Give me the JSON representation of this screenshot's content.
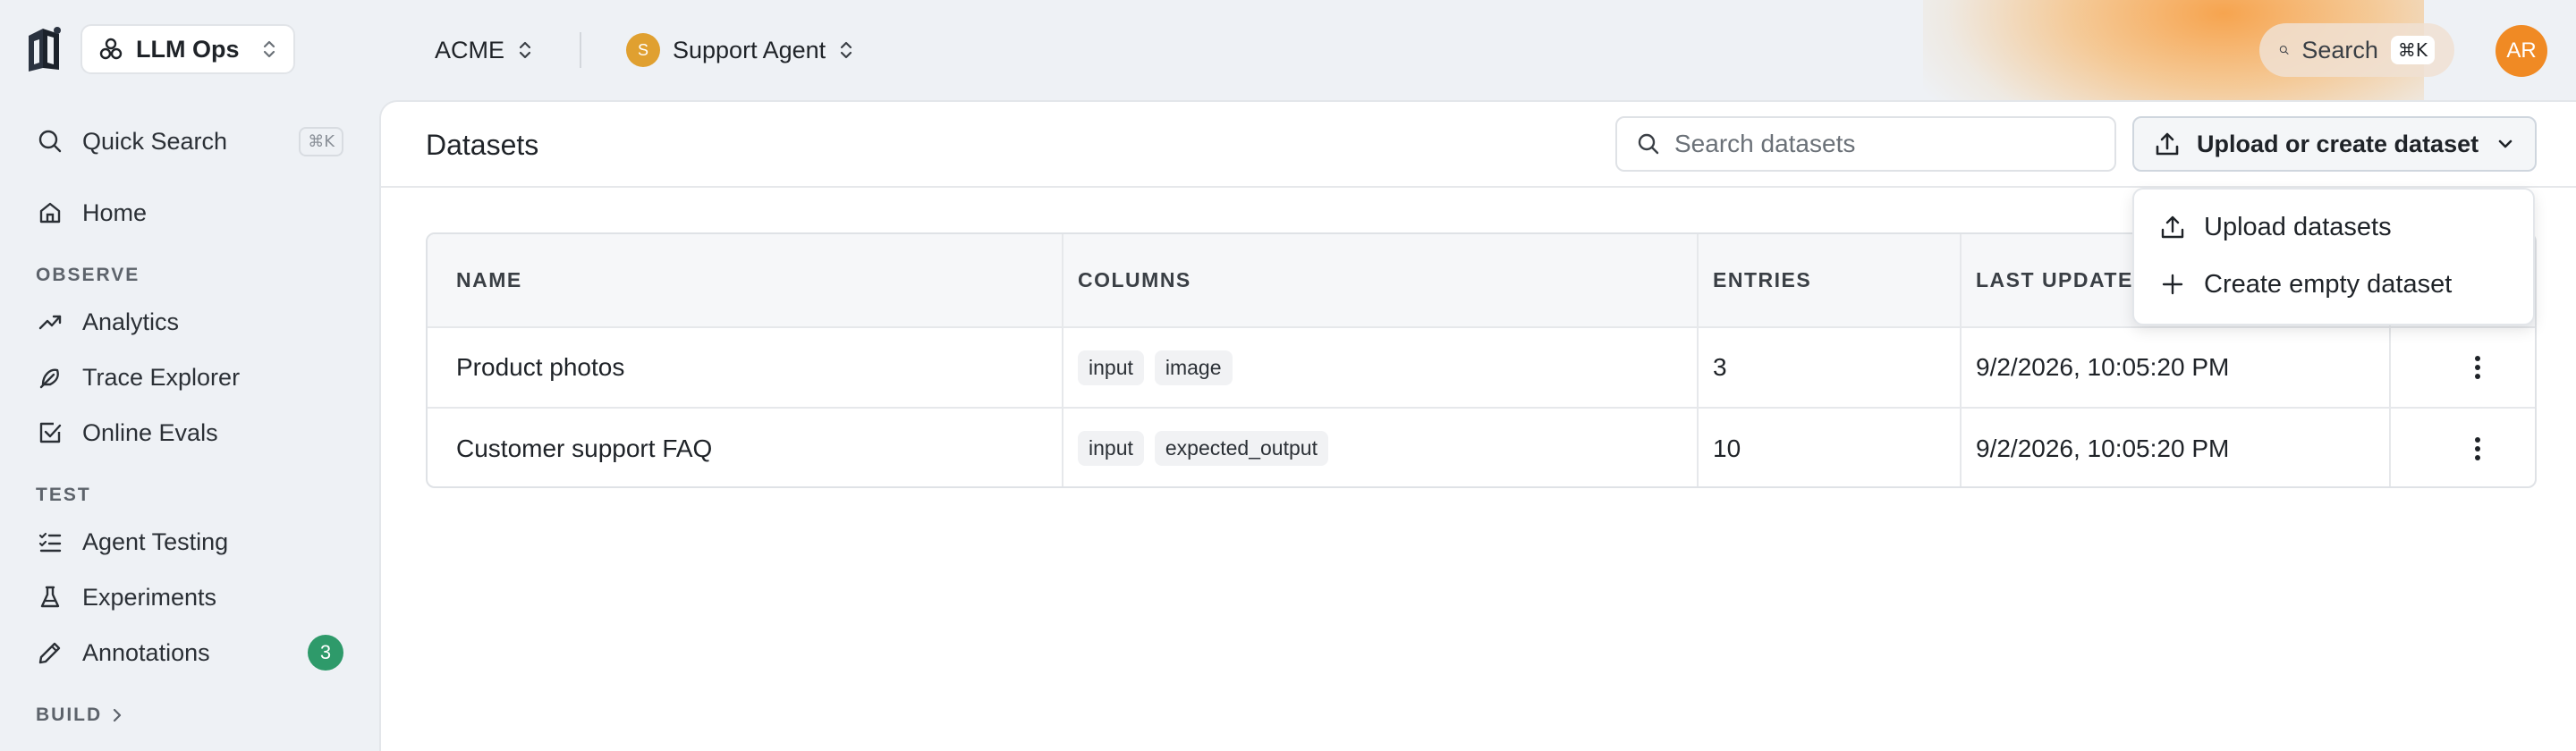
{
  "topbar": {
    "project": "LLM Ops",
    "org": "ACME",
    "agent": {
      "avatar_letter": "S",
      "name": "Support Agent"
    },
    "search": {
      "label": "Search",
      "shortcut": "⌘K"
    },
    "user_initials": "AR"
  },
  "sidebar": {
    "quick_search": {
      "label": "Quick Search",
      "shortcut": "⌘K"
    },
    "home": "Home",
    "sections": {
      "observe": "OBSERVE",
      "test": "TEST",
      "build": "BUILD"
    },
    "observe_items": [
      "Analytics",
      "Trace Explorer",
      "Online Evals"
    ],
    "test_items": [
      "Agent Testing",
      "Experiments",
      "Annotations"
    ],
    "annotations_badge": "3"
  },
  "main": {
    "title": "Datasets",
    "search_placeholder": "Search datasets",
    "upload_button": "Upload or create dataset",
    "table": {
      "headers": [
        "NAME",
        "COLUMNS",
        "ENTRIES",
        "LAST UPDATED"
      ],
      "rows": [
        {
          "name": "Product photos",
          "columns": [
            "input",
            "image"
          ],
          "entries": "3",
          "updated": "9/2/2026, 10:05:20 PM"
        },
        {
          "name": "Customer support FAQ",
          "columns": [
            "input",
            "expected_output"
          ],
          "entries": "10",
          "updated": "9/2/2026, 10:05:20 PM"
        }
      ]
    },
    "dropdown": {
      "upload": "Upload datasets",
      "create": "Create empty dataset"
    }
  }
}
